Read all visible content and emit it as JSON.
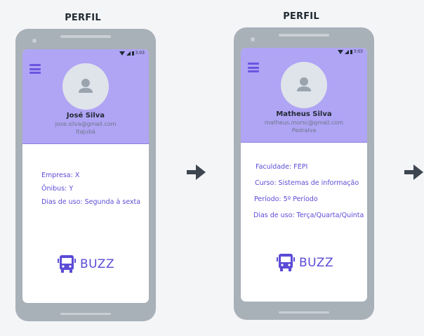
{
  "screens": [
    {
      "caption": "PERFIL",
      "status_time": "3:03",
      "name": "José Silva",
      "email": "jose.silva@gmail.com",
      "location": "Itajubá",
      "info": [
        "Empresa: X",
        "Ônibus: Y",
        "Dias de uso: Segunda à sexta"
      ]
    },
    {
      "caption": "PERFIL",
      "status_time": "3:03",
      "name": "Matheus Silva",
      "email": "matheus.morsc@gmail.com",
      "location": "Pedralva",
      "info": [
        "Faculdade: FEPI",
        "Curso: Sistemas de informação",
        "Período: 5º Período",
        "Dias de uso: Terça/Quarta/Quinta"
      ]
    }
  ],
  "brand": {
    "name": "BUZZ",
    "color": "#5b4bd6"
  },
  "colors": {
    "header": "#b0a4f5",
    "accent": "#6b55e0",
    "arrow": "#3d4650"
  },
  "icons": [
    "menu-icon",
    "avatar-icon",
    "bus-icon",
    "arrow-right-icon",
    "wifi-icon",
    "signal-icon",
    "battery-icon"
  ]
}
